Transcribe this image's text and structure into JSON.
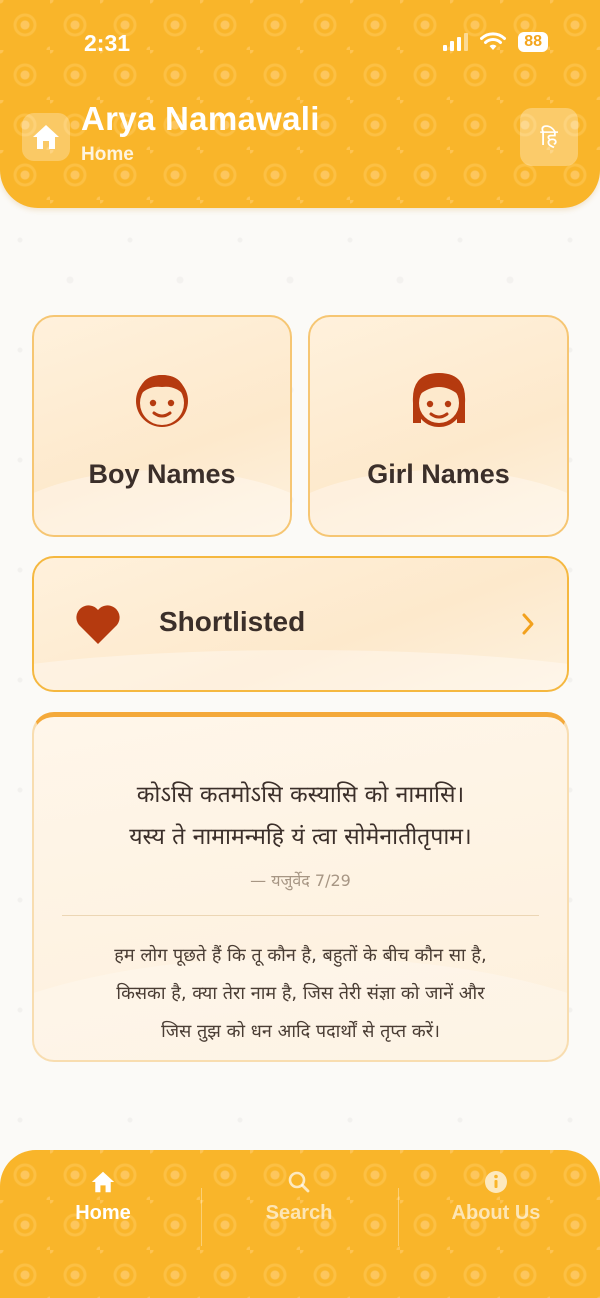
{
  "status_bar": {
    "time": "2:31",
    "battery": "88"
  },
  "header": {
    "title": "Arya Namawali",
    "subtitle": "Home",
    "lang_toggle": "हि"
  },
  "cards": {
    "boy_label": "Boy Names",
    "girl_label": "Girl Names",
    "shortlisted_label": "Shortlisted"
  },
  "verse": {
    "line1": "कोऽसि कतमोऽसि कस्यासि को नामासि।",
    "line2": "यस्य ते नामामन्महि यं त्वा सोमेनातीतृपाम।",
    "reference": "— यजुर्वेद 7/29",
    "meaning_lines": [
      "हम लोग पूछते हैं कि तू कौन है, बहुतों के बीच कौन सा है,",
      "किसका है, क्या तेरा नाम है, जिस तेरी संज्ञा को जानें और",
      "जिस तुझ को धन आदि पदार्थों से तृप्त करें।"
    ]
  },
  "nav": {
    "home": "Home",
    "search": "Search",
    "about": "About Us"
  },
  "colors": {
    "primary": "#f9b52a",
    "accent_dark": "#b53a0f",
    "card_bg": "#fde9cc",
    "text_dark": "#3b2f2a"
  },
  "icons": {
    "header_home": "home-icon",
    "heart": "heart-icon",
    "chevron": "chevron-right-icon",
    "search": "search-icon",
    "info": "info-icon"
  }
}
